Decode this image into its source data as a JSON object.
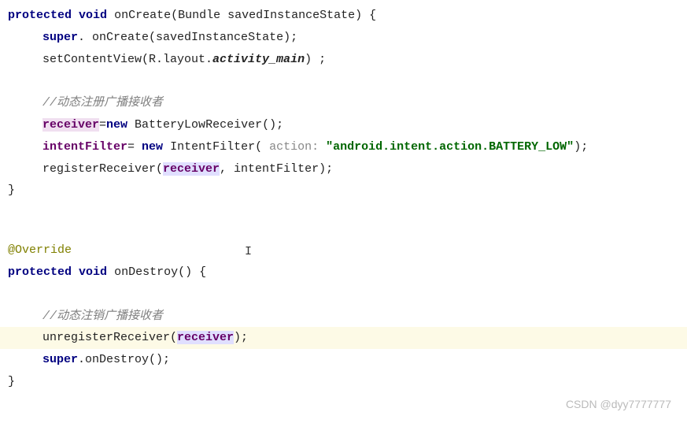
{
  "code": {
    "line1_kw1": "protected",
    "line1_kw2": "void",
    "line1_method": "onCreate",
    "line1_paramtype": "Bundle",
    "line1_paramname": "savedInstanceState",
    "line2_super": "super",
    "line2_call": "onCreate(savedInstanceState);",
    "line3_call1": "setContentView(R.layout.",
    "line3_layout": "activity_main",
    "line3_call2": ") ;",
    "comment1": "//动态注册广播接收者",
    "line5_recv": "receiver",
    "line5_eq": "=",
    "line5_new": "new",
    "line5_rest": " BatteryLowReceiver();",
    "line6_filt": "intentFilter",
    "line6_eq": "= ",
    "line6_new": "new",
    "line6_rest1": " IntentFilter( ",
    "line6_hint": "action:",
    "line6_space": " ",
    "line6_str": "\"android.intent.action.BATTERY_LOW\"",
    "line6_rest2": ");",
    "line7_call1": "registerReceiver(",
    "line7_recv": "receiver",
    "line7_mid": ", intentFilter);",
    "brace_close": "}",
    "override": "@Override",
    "line9_kw1": "protected",
    "line9_kw2": "void",
    "line9_method": "onDestroy",
    "line9_rest": "() {",
    "comment2": "//动态注销广播接收者",
    "line11_call1": "unregisterReceiver(",
    "line11_recv": "receiver",
    "line11_call2": ");",
    "line12_super": "super",
    "line12_call": ".onDestroy();",
    "watermark": "CSDN @dyy7777777"
  }
}
